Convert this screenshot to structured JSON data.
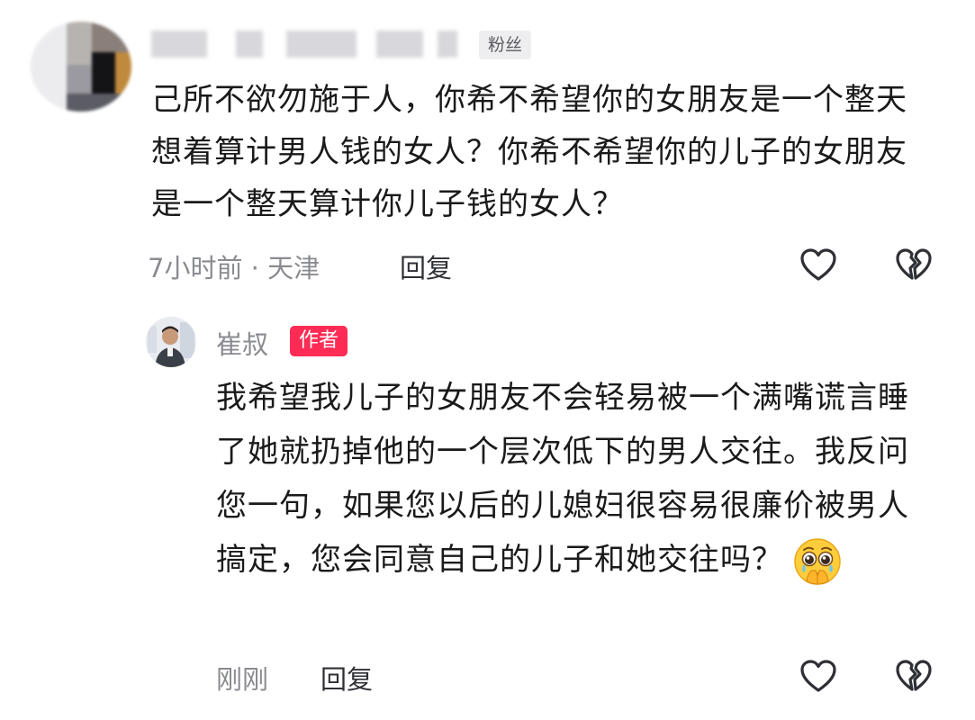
{
  "top_comment": {
    "badge": "粉丝",
    "text": "己所不欲勿施于人，你希不希望你的女朋友是一个整天想着算计男人钱的女人？你希不希望你的儿子的女朋友是一个整天算计你儿子钱的女人？",
    "time_location": "7小时前 · 天津",
    "reply_label": "回复",
    "like_icon": "heart-outline-icon",
    "dislike_icon": "broken-heart-icon"
  },
  "reply_comment": {
    "author_name": "崔叔",
    "author_badge": "作者",
    "text": "我希望我儿子的女朋友不会轻易被一个满嘴谎言睡了她就扔掉他的一个层次低下的男人交往。我反问您一句，如果您以后的儿媳妇很容易很廉价被男人搞定，您会同意自己的儿子和她交往吗？",
    "emoji_icon": "pleading-face-emoji-icon",
    "time": "刚刚",
    "reply_label": "回复",
    "like_icon": "heart-outline-icon",
    "dislike_icon": "broken-heart-icon"
  },
  "colors": {
    "author_badge_bg": "#fe2c55",
    "meta_text": "#8a8b91",
    "body_text": "#1a1a1a"
  }
}
